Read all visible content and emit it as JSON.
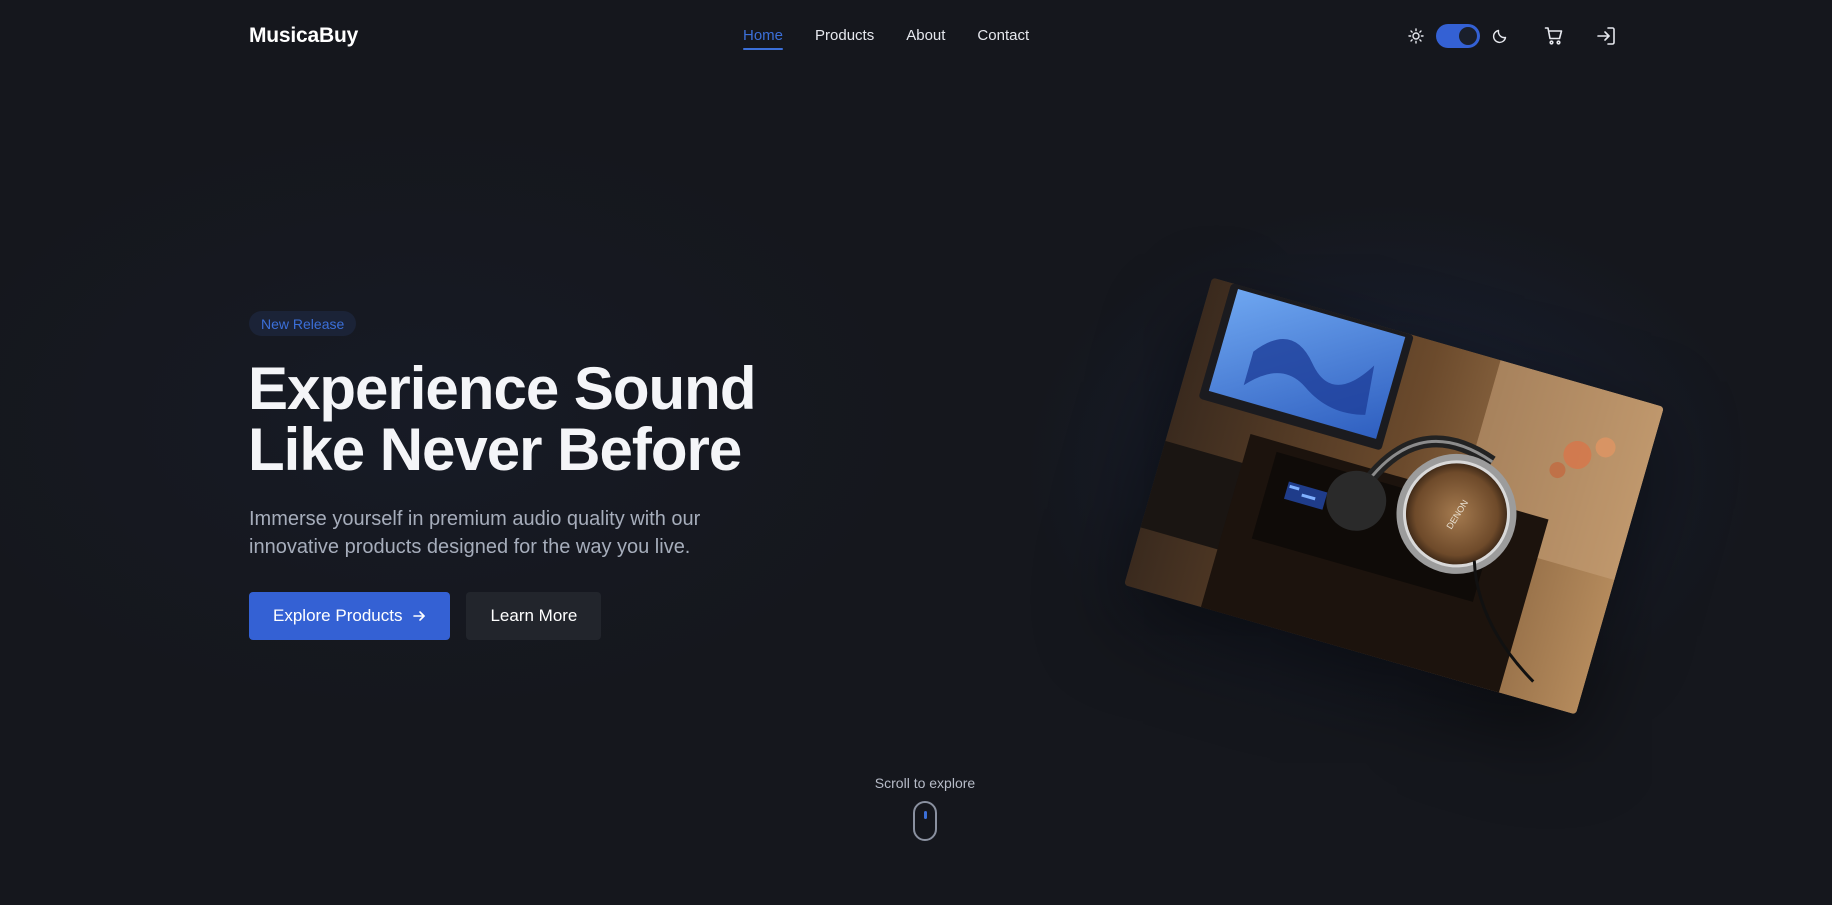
{
  "brand": {
    "name": "MusicaBuy",
    "accent": "#3461d4"
  },
  "nav": {
    "items": [
      {
        "label": "Home",
        "active": true
      },
      {
        "label": "Products",
        "active": false
      },
      {
        "label": "About",
        "active": false
      },
      {
        "label": "Contact",
        "active": false
      }
    ]
  },
  "header": {
    "theme_toggle": {
      "left_icon": "sun-icon",
      "right_icon": "moon-icon",
      "state": "dark"
    },
    "cart_icon": "cart-icon",
    "login_icon": "login-icon"
  },
  "hero": {
    "badge": "New Release",
    "title_line1": "Experience Sound",
    "title_line2": "Like Never Before",
    "subtitle_line1": "Immerse yourself in premium audio quality with our",
    "subtitle_line2": "innovative products designed for the way you live.",
    "primary_button": "Explore Products",
    "secondary_button": "Learn More",
    "image_brand_text": "DENON"
  },
  "scroll": {
    "label": "Scroll to explore"
  }
}
